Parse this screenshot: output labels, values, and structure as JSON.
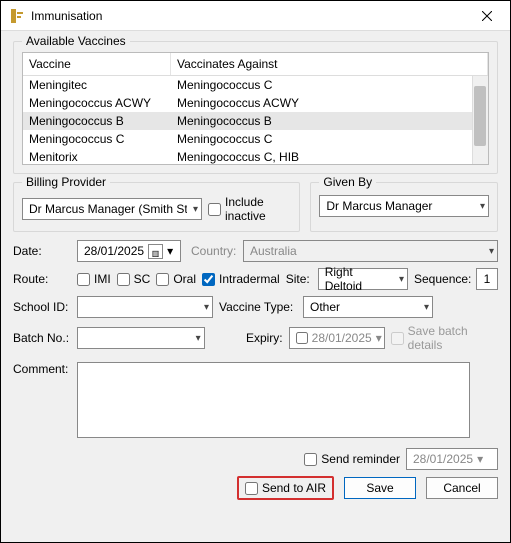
{
  "titlebar": {
    "title": "Immunisation"
  },
  "available": {
    "group_label": "Available Vaccines",
    "col1": "Vaccine",
    "col2": "Vaccinates Against",
    "rows": [
      {
        "v": "Meningitec",
        "a": "Meningococcus C",
        "sel": false
      },
      {
        "v": "Meningococcus ACWY",
        "a": "Meningococcus ACWY",
        "sel": false
      },
      {
        "v": "Meningococcus B",
        "a": "Meningococcus B",
        "sel": true
      },
      {
        "v": "Meningococcus C",
        "a": "Meningococcus C",
        "sel": false
      },
      {
        "v": "Menitorix",
        "a": "Meningococcus C, HIB",
        "sel": false
      }
    ]
  },
  "billing": {
    "group_label": "Billing Provider",
    "selected": "Dr Marcus Manager (Smith Street P",
    "include_inactive_label": "Include inactive"
  },
  "given_by": {
    "group_label": "Given By",
    "selected": "Dr Marcus Manager"
  },
  "date": {
    "label": "Date:",
    "value": "28/01/2025"
  },
  "country": {
    "label": "Country:",
    "value": "Australia"
  },
  "route": {
    "label": "Route:",
    "opts": {
      "imi": "IMI",
      "sc": "SC",
      "oral": "Oral",
      "intradermal": "Intradermal"
    },
    "checked": "intradermal",
    "site_label": "Site:",
    "site_value": "Right Deltoid",
    "sequence_label": "Sequence:",
    "sequence_value": "1"
  },
  "school": {
    "label": "School ID:",
    "value": ""
  },
  "vactype": {
    "label": "Vaccine Type:",
    "value": "Other"
  },
  "batch": {
    "label": "Batch No.:",
    "value": "",
    "expiry_label": "Expiry:",
    "expiry_value": "28/01/2025",
    "save_label": "Save batch details"
  },
  "comment": {
    "label": "Comment:",
    "value": ""
  },
  "reminder": {
    "label": "Send reminder",
    "date": "28/01/2025"
  },
  "footer": {
    "air_label": "Send to AIR",
    "save": "Save",
    "cancel": "Cancel"
  }
}
